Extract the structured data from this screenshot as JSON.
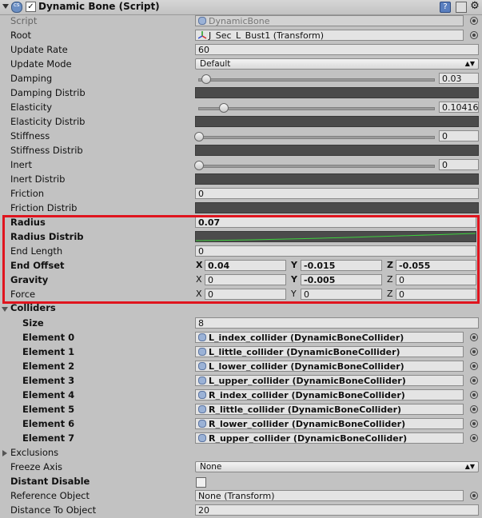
{
  "header": {
    "title": "Dynamic Bone (Script)",
    "checkbox": "✓",
    "help_icon": "?",
    "gear_icon": "⚙"
  },
  "props": {
    "script": {
      "label": "Script",
      "value": "DynamicBone"
    },
    "root": {
      "label": "Root",
      "value": "J_Sec_L_Bust1 (Transform)"
    },
    "update_rate": {
      "label": "Update Rate",
      "value": "60"
    },
    "update_mode": {
      "label": "Update Mode",
      "value": "Default"
    },
    "damping": {
      "label": "Damping",
      "value": "0.03",
      "fraction": 0.03
    },
    "damping_distrib": {
      "label": "Damping Distrib"
    },
    "elasticity": {
      "label": "Elasticity",
      "value": "0.10416",
      "fraction": 0.104
    },
    "elasticity_distrib": {
      "label": "Elasticity Distrib"
    },
    "stiffness": {
      "label": "Stiffness",
      "value": "0",
      "fraction": 0
    },
    "stiffness_distrib": {
      "label": "Stiffness Distrib"
    },
    "inert": {
      "label": "Inert",
      "value": "0",
      "fraction": 0
    },
    "inert_distrib": {
      "label": "Inert Distrib"
    },
    "friction": {
      "label": "Friction",
      "value": "0"
    },
    "friction_distrib": {
      "label": "Friction Distrib"
    },
    "radius": {
      "label": "Radius",
      "value": "0.07"
    },
    "radius_distrib": {
      "label": "Radius Distrib"
    },
    "end_length": {
      "label": "End Length",
      "value": "0"
    },
    "end_offset": {
      "label": "End Offset",
      "x": "0.04",
      "y": "-0.015",
      "z": "-0.055"
    },
    "gravity": {
      "label": "Gravity",
      "x": "0",
      "y": "-0.005",
      "z": "0"
    },
    "force": {
      "label": "Force",
      "x": "0",
      "y": "0",
      "z": "0"
    }
  },
  "axes": {
    "x": "X",
    "y": "Y",
    "z": "Z"
  },
  "colliders": {
    "label": "Colliders",
    "size_label": "Size",
    "size": "8",
    "elements": [
      {
        "label": "Element 0",
        "value": "L_index_collider (DynamicBoneCollider)"
      },
      {
        "label": "Element 1",
        "value": "L_little_collider (DynamicBoneCollider)"
      },
      {
        "label": "Element 2",
        "value": "L_lower_collider (DynamicBoneCollider)"
      },
      {
        "label": "Element 3",
        "value": "L_upper_collider (DynamicBoneCollider)"
      },
      {
        "label": "Element 4",
        "value": "R_index_collider (DynamicBoneCollider)"
      },
      {
        "label": "Element 5",
        "value": "R_little_collider (DynamicBoneCollider)"
      },
      {
        "label": "Element 6",
        "value": "R_lower_collider (DynamicBoneCollider)"
      },
      {
        "label": "Element 7",
        "value": "R_upper_collider (DynamicBoneCollider)"
      }
    ]
  },
  "exclusions": {
    "label": "Exclusions"
  },
  "freeze_axis": {
    "label": "Freeze Axis",
    "value": "None"
  },
  "distant_disable": {
    "label": "Distant Disable"
  },
  "reference_object": {
    "label": "Reference Object",
    "value": "None (Transform)"
  },
  "distance_to_object": {
    "label": "Distance To Object",
    "value": "20"
  },
  "colors": {
    "highlight": "#e0141e",
    "curve": "#3fd23f",
    "curve_bg": "#4b4b4b"
  }
}
